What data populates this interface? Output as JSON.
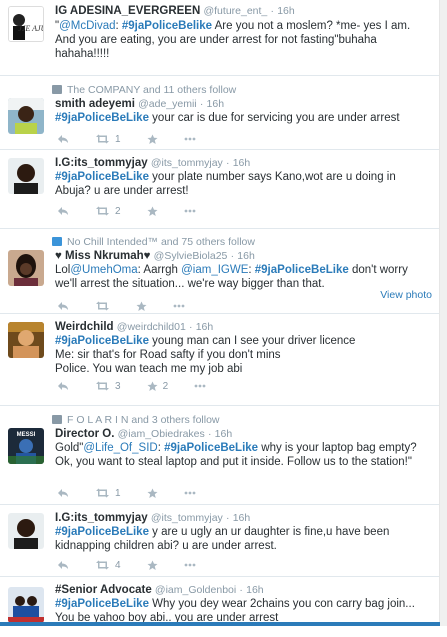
{
  "colors": {
    "link": "#2b7bb9",
    "meta": "#8899a6",
    "text": "#292f33",
    "retweet_context": "#3b94d9"
  },
  "tweets": [
    {
      "name": "IG ADESINA_EVERGREEN",
      "handle": "@future_ent_",
      "time": "16h",
      "avatar_text": "JJE AJUN",
      "text": [
        {
          "t": "\"",
          "k": "plain"
        },
        {
          "t": "@McDivad",
          "k": "mention"
        },
        {
          "t": ": ",
          "k": "plain"
        },
        {
          "t": "#9jaPoliceBelike",
          "k": "tag"
        },
        {
          "t": " Are you not a moslem? *me- yes I am. And you are eating, you are under arrest for not fasting\"buhaha hahaha!!!!!",
          "k": "plain"
        }
      ]
    },
    {
      "context": "The COMPANY and 11 others follow",
      "name": "smith adeyemi",
      "handle": "@ade_yemii",
      "time": "16h",
      "text": [
        {
          "t": "#9jaPoliceBeLike",
          "k": "tag"
        },
        {
          "t": " your car is due for servicing you are under arrest",
          "k": "plain"
        }
      ],
      "retweets": "1",
      "favorites": ""
    },
    {
      "name": "I.G:its_tommyjay",
      "handle": "@its_tommyjay",
      "time": "16h",
      "text": [
        {
          "t": "#9jaPoliceBeLike",
          "k": "tag"
        },
        {
          "t": " your plate number says Kano,wot are u doing in Abuja? u are under arrest!",
          "k": "plain"
        }
      ],
      "retweets": "2",
      "favorites": ""
    },
    {
      "context": "No Chill Intended™ and 75 others follow",
      "name": "♥ Miss Nkrumah♥",
      "handle": "@SylvieBiola25",
      "time": "16h",
      "text": [
        {
          "t": "Lol",
          "k": "plain"
        },
        {
          "t": "@UmehOma",
          "k": "mention"
        },
        {
          "t": ": Aarrgh ",
          "k": "plain"
        },
        {
          "t": "@iam_IGWE",
          "k": "mention"
        },
        {
          "t": ": ",
          "k": "plain"
        },
        {
          "t": "#9jaPoliceBeLike",
          "k": "tag"
        },
        {
          "t": " don't worry we'll arrest the situation... we're way bigger than that.",
          "k": "plain"
        }
      ],
      "view_photo": "View photo"
    },
    {
      "name": "Weirdchild",
      "handle": "@weirdchild01",
      "time": "16h",
      "text": [
        {
          "t": "#9jaPoliceBeLike",
          "k": "tag"
        },
        {
          "t": " young man can I see your driver licence\nMe: sir that's for Road safty if you don't mins\nPolice. You wan teach me my job abi",
          "k": "plain"
        }
      ],
      "retweets": "3",
      "favorites": "2"
    },
    {
      "context": "F O L A R I N and 3 others follow",
      "name": "Director O.",
      "handle": "@iam_Obiedrakes",
      "time": "16h",
      "avatar_text": "MESSI",
      "text": [
        {
          "t": "Gold\"",
          "k": "plain"
        },
        {
          "t": "@Life_Of_SID",
          "k": "mention"
        },
        {
          "t": ": ",
          "k": "plain"
        },
        {
          "t": "#9jaPoliceBeLike",
          "k": "tag"
        },
        {
          "t": " why is your laptop bag empty? Ok, you want to steal laptop and put it inside. Follow us to the station!\"",
          "k": "plain"
        }
      ],
      "retweets": "1",
      "favorites": ""
    },
    {
      "name": "I.G:its_tommyjay",
      "handle": "@its_tommyjay",
      "time": "16h",
      "text": [
        {
          "t": "#9jaPoliceBeLike",
          "k": "tag"
        },
        {
          "t": " y are u ugly an ur daughter is fine,u have been kidnapping children abi? u are under arrest.",
          "k": "plain"
        }
      ],
      "retweets": "4",
      "favorites": ""
    },
    {
      "name": "#Senior Advocate",
      "handle": "@iam_Goldenboi",
      "time": "16h",
      "text": [
        {
          "t": "#9jaPoliceBeLike",
          "k": "tag"
        },
        {
          "t": " Why you  dey wear 2chains you con carry bag join... You be yahoo boy abi.. you are under arrest",
          "k": "plain"
        }
      ]
    }
  ]
}
